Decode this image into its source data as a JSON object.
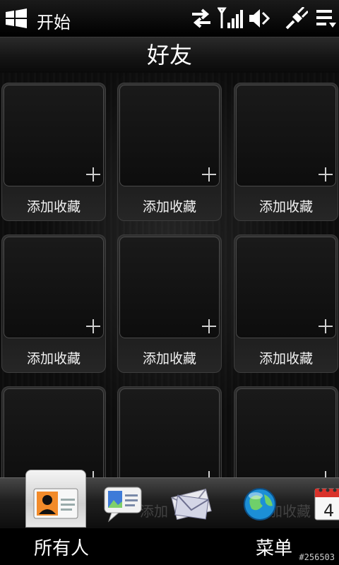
{
  "statusbar": {
    "start_label": "开始",
    "icons": [
      "windows-logo-icon",
      "data-transfer-icon",
      "signal-strength-icon",
      "volume-icon",
      "usb-plug-icon",
      "menu-icon"
    ]
  },
  "titlebar": {
    "title": "好友"
  },
  "favorites": {
    "add_label": "添加收藏",
    "tiles": [
      {
        "label": "添加收藏"
      },
      {
        "label": "添加收藏"
      },
      {
        "label": "添加收藏"
      },
      {
        "label": "添加收藏"
      },
      {
        "label": "添加收藏"
      },
      {
        "label": "添加收藏"
      },
      {
        "label": ""
      },
      {
        "label": ""
      },
      {
        "label": ""
      }
    ]
  },
  "dock": {
    "items": [
      "contacts-card-icon",
      "message-bubble-icon",
      "mail-icon",
      "internet-globe-icon",
      "calendar-icon"
    ],
    "calendar_day": "4",
    "faded_text_left": "添加",
    "faded_text_right": "加收藏"
  },
  "softkeys": {
    "left": "所有人",
    "right": "菜单"
  },
  "watermark": "#256503"
}
